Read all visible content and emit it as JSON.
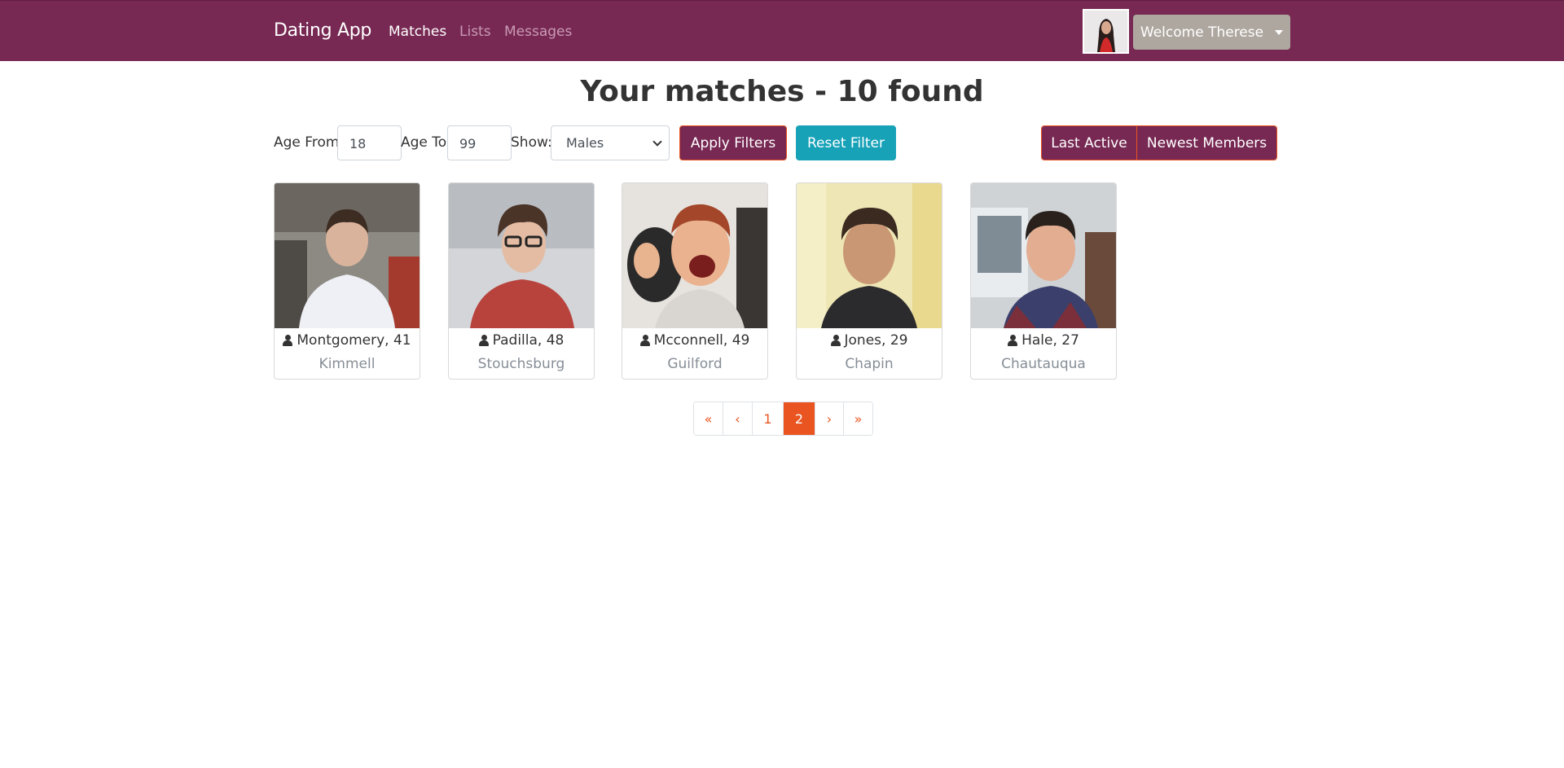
{
  "navbar": {
    "brand": "Dating App",
    "links": [
      {
        "label": "Matches",
        "active": true
      },
      {
        "label": "Lists",
        "active": false
      },
      {
        "label": "Messages",
        "active": false
      }
    ],
    "welcome": "Welcome Therese"
  },
  "page": {
    "title": "Your matches - 10 found"
  },
  "filters": {
    "age_from_label": "Age From",
    "age_from_value": "18",
    "age_to_label": "Age To",
    "age_to_value": "99",
    "show_label": "Show:",
    "show_value": "Males",
    "apply_label": "Apply Filters",
    "reset_label": "Reset Filter"
  },
  "sort": {
    "last_active": "Last Active",
    "newest_members": "Newest Members"
  },
  "members": [
    {
      "name": "Montgomery, 41",
      "city": "Kimmell"
    },
    {
      "name": "Padilla, 48",
      "city": "Stouchsburg"
    },
    {
      "name": "Mcconnell, 49",
      "city": "Guilford"
    },
    {
      "name": "Jones, 29",
      "city": "Chapin"
    },
    {
      "name": "Hale, 27",
      "city": "Chautauqua"
    }
  ],
  "pagination": {
    "first": "«",
    "prev": "‹",
    "pages": [
      "1",
      "2"
    ],
    "current": "2",
    "next": "›",
    "last": "»"
  },
  "colors": {
    "primary": "#772953",
    "accent": "#e95420",
    "info": "#17a2b8",
    "secondary": "#aea79f"
  }
}
